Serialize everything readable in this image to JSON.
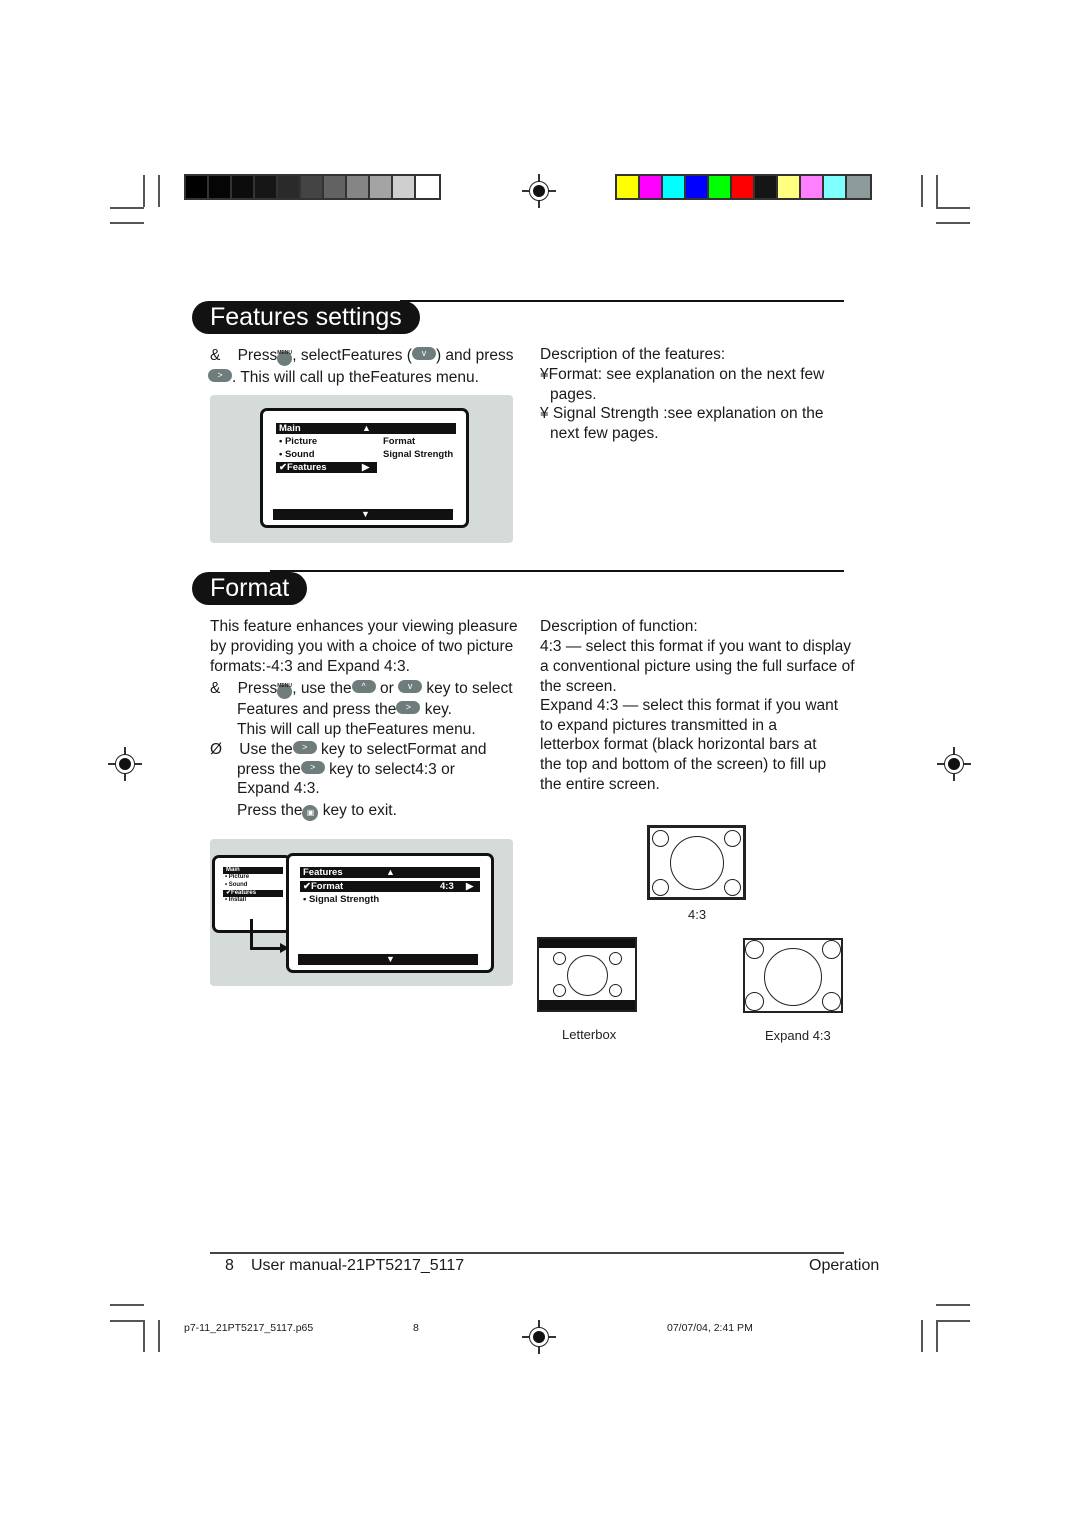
{
  "print_marks": {
    "gray_swatches": [
      "#000000",
      "#050505",
      "#0c0c0c",
      "#161616",
      "#2a2a2a",
      "#444444",
      "#626262",
      "#858585",
      "#a4a4a4",
      "#cfcfcf",
      "#ffffff"
    ],
    "color_swatches": [
      "#ffff00",
      "#ff00ff",
      "#00ffff",
      "#0000ff",
      "#00ff00",
      "#ff0000",
      "#151515",
      "#ffff80",
      "#ff80ff",
      "#80ffff",
      "#8c9c9c"
    ]
  },
  "features_settings": {
    "title": "Features settings",
    "step1": {
      "bullet": "&",
      "t1": "Press",
      "t2": ", select",
      "t3": "Features",
      "t4": " (",
      "t5": ") and press",
      "t6": ". This will call up the",
      "t7": "Features",
      "t8": " menu."
    },
    "keys": {
      "down": "v",
      "up": "^",
      "right": ">",
      "osd": "▣"
    },
    "osd": {
      "header": "Main",
      "up_arrow": "▲",
      "down_arrow": "▼",
      "items": [
        "• Picture",
        "• Sound",
        "✔Features"
      ],
      "selected_arrow": "▶",
      "submenu": [
        "Format",
        "Signal Strength"
      ]
    },
    "description": {
      "heading": "Description of the features:",
      "b1_bullet": "¥",
      "b1_label": "Format:",
      "b1_text": " see explanation on the next few",
      "b1_cont": "pages.",
      "b2_bullet": "¥",
      "b2_label": " Signal Strength",
      "b2_text": "  :see explanation on the",
      "b2_cont": "next few pages."
    }
  },
  "format": {
    "title": "Format",
    "intro": [
      "This feature enhances your viewing pleasure",
      "by providing you with a choice of two picture",
      "formats:-4:3 and Expand 4:3."
    ],
    "step1": {
      "bullet": "&",
      "t1": "Press",
      "t2": ", use the",
      "t3": " or ",
      "t4": " key to select",
      "l2a": "Features",
      "l2b": "  and press the",
      "l2c": " key.",
      "l3a": "This will call up the",
      "l3b": "Features",
      "l3c": "  menu."
    },
    "step2": {
      "bullet": "Ø",
      "t1": "Use the",
      "t2": " key to select",
      "t3": "Format",
      "t4": "  and",
      "l2a": "press the",
      "l2b": " key to select",
      "l2c": "4:3 or",
      "l3": "Expand 4:3.",
      "l4a": "Press the",
      "l4b": " key to exit."
    },
    "osd_small": {
      "header": "Main",
      "items": [
        "• Picture",
        "• Sound",
        "✔Features",
        "• Install"
      ]
    },
    "osd_large": {
      "header": "Features",
      "up_arrow": "▲",
      "down_arrow": "▼",
      "selected": "✔Format",
      "selected_value": "4:3",
      "selected_arrow": "▶",
      "item2": "• Signal Strength"
    },
    "description": [
      "Description of function:",
      "4:3 — select this format if you want to display",
      "a conventional picture using the full surface of",
      "the screen.",
      "Expand 4:3 — select this format if you want",
      "to expand pictures transmitted in a",
      " letterbox  format (black horizontal bars at",
      "the top and bottom of the screen) to fill up",
      "the entire screen."
    ],
    "diagrams": {
      "cap_43": "4:3",
      "cap_letterbox": "Letterbox",
      "cap_expand": "Expand 4:3"
    }
  },
  "footer": {
    "page_num": "8",
    "manual": "User manual-21PT5217_5117",
    "section": "Operation"
  },
  "slug": {
    "file": "p7-11_21PT5217_5117.p65",
    "page": "8",
    "date": "07/07/04, 2:41 PM"
  }
}
